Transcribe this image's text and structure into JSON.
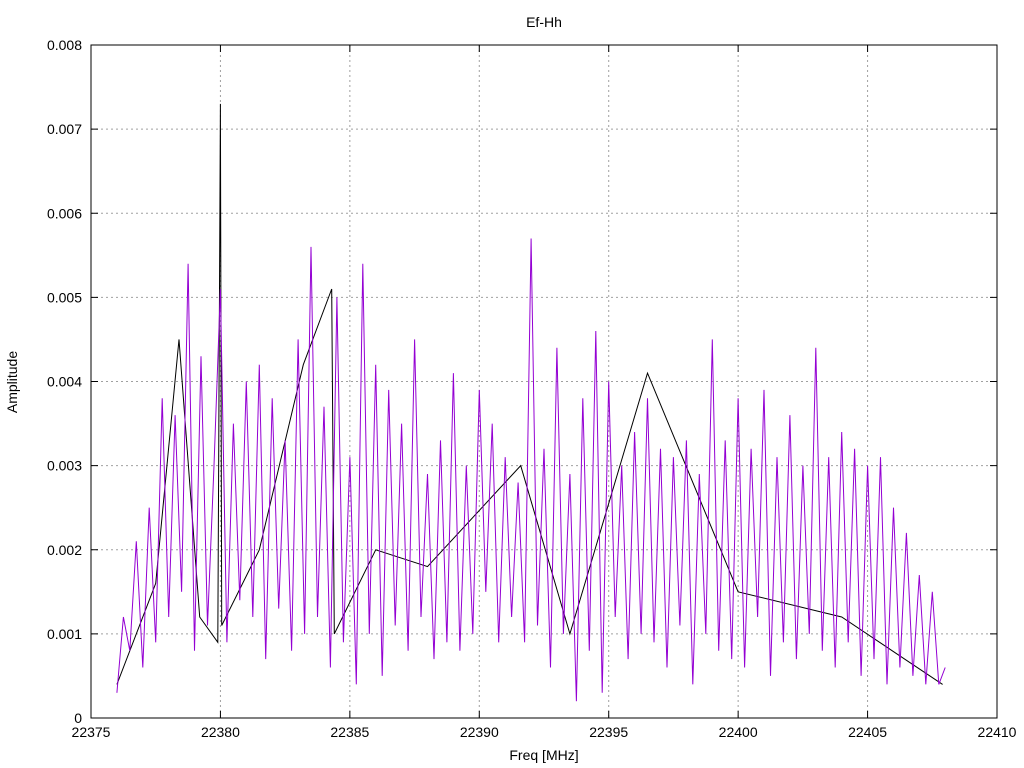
{
  "chart_data": {
    "type": "line",
    "title": "Ef-Hh",
    "xlabel": "Freq [MHz]",
    "ylabel": "Amplitude",
    "xlim": [
      22375,
      22410
    ],
    "ylim": [
      0,
      0.008
    ],
    "xticks": [
      22375,
      22380,
      22385,
      22390,
      22395,
      22400,
      22405,
      22410
    ],
    "xtick_labels": [
      "22375",
      "22380",
      "22385",
      "22390",
      "22395",
      "22400",
      "22405",
      "22410"
    ],
    "yticks": [
      0,
      0.001,
      0.002,
      0.003,
      0.004,
      0.005,
      0.006,
      0.007,
      0.008
    ],
    "ytick_labels": [
      "0",
      "0.001",
      "0.002",
      "0.003",
      "0.004",
      "0.005",
      "0.006",
      "0.007",
      "0.008"
    ],
    "grid": true,
    "legend": "none",
    "series": [
      {
        "name": "black",
        "color": "#000000",
        "x": [
          22376.0,
          22377.5,
          22378.4,
          22379.2,
          22379.9,
          22380.0,
          22380.05,
          22381.5,
          22383.2,
          22384.3,
          22384.4,
          22386.0,
          22388.0,
          22391.6,
          22393.5,
          22396.5,
          22400.0,
          22404.0,
          22407.9
        ],
        "values": [
          0.0004,
          0.0016,
          0.0045,
          0.0012,
          0.0009,
          0.0073,
          0.0011,
          0.002,
          0.0042,
          0.0051,
          0.001,
          0.002,
          0.0018,
          0.003,
          0.001,
          0.0041,
          0.0015,
          0.0012,
          0.0004
        ]
      },
      {
        "name": "purple",
        "color": "#9400d3",
        "x_start": 22376.0,
        "x_step": 0.25,
        "values": [
          0.0003,
          0.0012,
          0.0008,
          0.0021,
          0.0006,
          0.0025,
          0.0009,
          0.0038,
          0.0012,
          0.0036,
          0.0015,
          0.0054,
          0.0008,
          0.0043,
          0.0011,
          0.003,
          0.0051,
          0.0009,
          0.0035,
          0.0014,
          0.004,
          0.0012,
          0.0042,
          0.0007,
          0.0038,
          0.0013,
          0.0033,
          0.0008,
          0.0045,
          0.001,
          0.0056,
          0.0012,
          0.0037,
          0.0006,
          0.005,
          0.0009,
          0.0031,
          0.0004,
          0.0054,
          0.001,
          0.0042,
          0.0005,
          0.0039,
          0.0011,
          0.0035,
          0.0008,
          0.0045,
          0.0012,
          0.0029,
          0.0007,
          0.0033,
          0.0009,
          0.0041,
          0.0008,
          0.003,
          0.001,
          0.0039,
          0.0015,
          0.0035,
          0.0009,
          0.0031,
          0.0012,
          0.0028,
          0.0009,
          0.0057,
          0.0011,
          0.0032,
          0.0006,
          0.0044,
          0.001,
          0.0029,
          0.0002,
          0.0038,
          0.0008,
          0.0046,
          0.0003,
          0.004,
          0.0012,
          0.003,
          0.0007,
          0.0034,
          0.001,
          0.0038,
          0.0009,
          0.0032,
          0.0006,
          0.0031,
          0.0011,
          0.0033,
          0.0004,
          0.0029,
          0.001,
          0.0045,
          0.0008,
          0.0033,
          0.0007,
          0.0038,
          0.0006,
          0.0032,
          0.0012,
          0.0039,
          0.0005,
          0.0031,
          0.0009,
          0.0036,
          0.0007,
          0.003,
          0.001,
          0.0044,
          0.0008,
          0.0031,
          0.0006,
          0.0034,
          0.0009,
          0.0032,
          0.0005,
          0.003,
          0.0007,
          0.0031,
          0.0004,
          0.0025,
          0.0006,
          0.0022,
          0.0005,
          0.0017,
          0.0004,
          0.0015,
          0.0004,
          0.0006
        ]
      }
    ]
  }
}
